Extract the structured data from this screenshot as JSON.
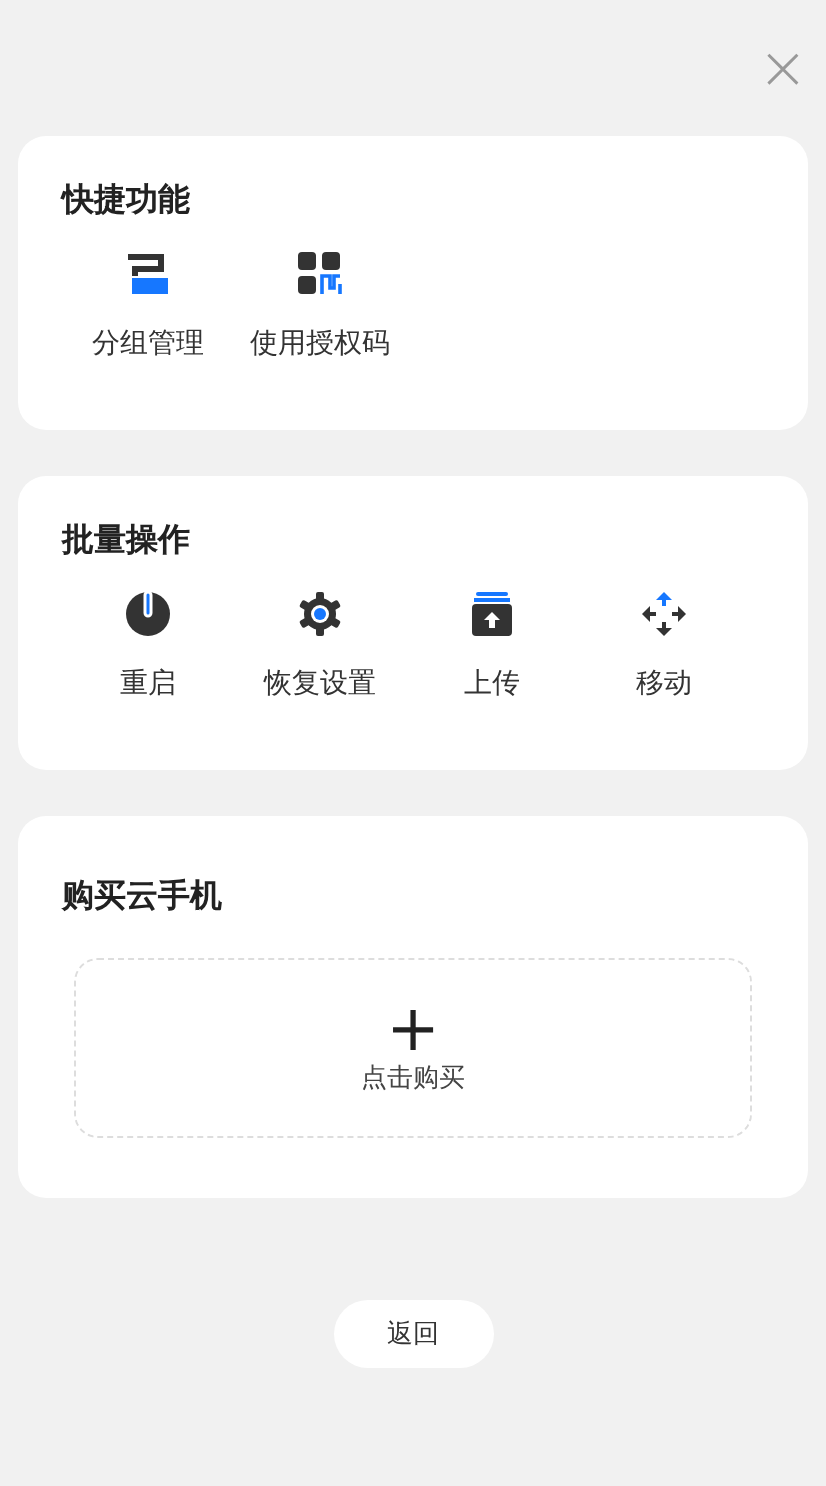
{
  "close_button": {
    "label": "×"
  },
  "sections": [
    {
      "title": "快捷功能",
      "kind": "actions",
      "items": [
        {
          "label": "分组管理",
          "kind": "group"
        },
        {
          "label": "使用授权码",
          "kind": "code"
        }
      ]
    },
    {
      "title": "批量操作",
      "kind": "actions",
      "items": [
        {
          "label": "重启",
          "kind": "power"
        },
        {
          "label": "恢复设置",
          "kind": "gear"
        },
        {
          "label": "上传",
          "kind": "upload"
        },
        {
          "label": "移动",
          "kind": "move"
        }
      ]
    },
    {
      "title": "购买云手机",
      "kind": "buy",
      "button": {
        "icon_text": "+",
        "label": "点击购买"
      }
    }
  ],
  "back_button": {
    "label": "返回"
  }
}
